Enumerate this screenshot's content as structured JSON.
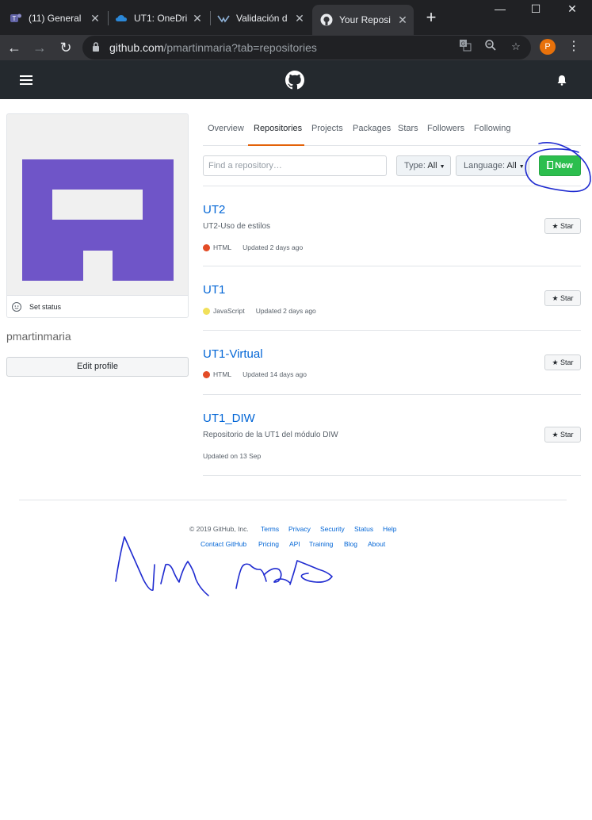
{
  "browser": {
    "tabs": [
      {
        "title": "(11) General",
        "icon": "teams-icon"
      },
      {
        "title": "UT1: OneDri",
        "icon": "onedrive-icon"
      },
      {
        "title": "Validación d",
        "icon": "validator-icon"
      },
      {
        "title": "Your Reposi",
        "icon": "github-icon",
        "active": true
      }
    ],
    "new_tab_label": "+",
    "window_controls": {
      "minimize": "—",
      "maximize": "☐",
      "close": "✕"
    },
    "url_host": "github.com",
    "url_path": "/pmartinmaria?tab=repositories",
    "profile_initial": "P"
  },
  "profile": {
    "set_status": "Set status",
    "username": "pmartinmaria",
    "edit_profile": "Edit profile",
    "avatar_color": "#6f55c8"
  },
  "nav_tabs": [
    "Overview",
    "Repositories",
    "Projects",
    "Packages",
    "Stars",
    "Followers",
    "Following"
  ],
  "filters": {
    "search_placeholder": "Find a repository…",
    "type_label": "Type:",
    "type_value": "All",
    "language_label": "Language:",
    "language_value": "All",
    "new_button": "New"
  },
  "repositories": [
    {
      "name": "UT2",
      "description": "UT2-Uso de estilos",
      "language": "HTML",
      "language_color": "#e34c26",
      "updated": "Updated 2 days ago",
      "star": "Star"
    },
    {
      "name": "UT1",
      "description": "",
      "language": "JavaScript",
      "language_color": "#f1e05a",
      "updated": "Updated 2 days ago",
      "star": "Star"
    },
    {
      "name": "UT1-Virtual",
      "description": "",
      "language": "HTML",
      "language_color": "#e34c26",
      "updated": "Updated 14 days ago",
      "star": "Star"
    },
    {
      "name": "UT1_DIW",
      "description": "Repositorio de la UT1 del módulo DIW",
      "language": "",
      "language_color": "",
      "updated": "Updated on 13 Sep",
      "star": "Star"
    }
  ],
  "footer": {
    "copyright": "© 2019 GitHub, Inc.",
    "row1_links": [
      "Terms",
      "Privacy",
      "Security",
      "Status",
      "Help"
    ],
    "row2_links": [
      "Contact GitHub",
      "Pricing",
      "API",
      "Training",
      "Blog",
      "About"
    ]
  },
  "colors": {
    "accent": "#e36209",
    "link": "#0366d6",
    "new_button": "#2cbe4e",
    "annotation_ink": "#1f2bd0"
  }
}
